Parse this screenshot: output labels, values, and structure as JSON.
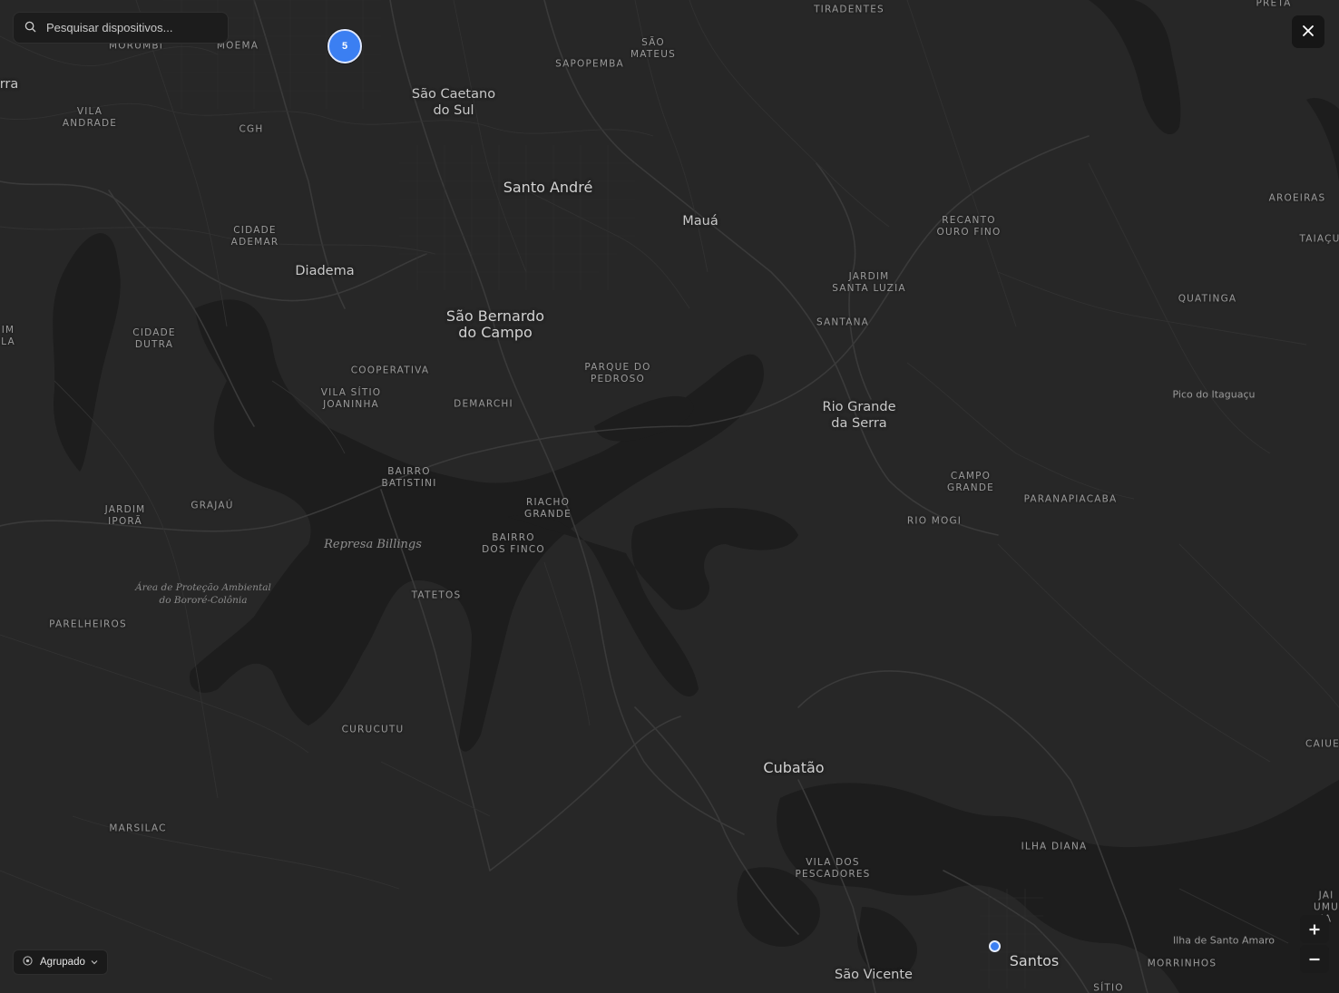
{
  "search": {
    "placeholder": "Pesquisar dispositivos..."
  },
  "cluster": {
    "count": "5"
  },
  "mode_selector": {
    "label": "Agrupado"
  },
  "zoom": {
    "in_label": "+",
    "out_label": "−"
  },
  "icons": {
    "search": "search-icon",
    "close": "close-icon",
    "mode": "target-icon",
    "chevron": "chevron-down-icon"
  },
  "colors": {
    "background": "#272727",
    "water": "#1d1d1d",
    "roads": "#3a3a3a",
    "marker": "#3b7ff2"
  },
  "map": {
    "cities": {
      "santo_andre": "Santo André",
      "sao_caetano": "São Caetano\ndo Sul",
      "maua": "Mauá",
      "diadema": "Diadema",
      "sao_bernardo": "São Bernardo\ndo Campo",
      "rio_grande_serra": "Rio Grande\nda Serra",
      "cubatao": "Cubatão",
      "santos": "Santos",
      "sao_vicente": "São Vicente",
      "edge_left": "rra"
    },
    "districts": {
      "tiradentes": "TIRADENTES",
      "preta": "PRETA",
      "morumbi": "MORUMBI",
      "moema": "MOEMA",
      "sao_mateus": "SÃO\nMATEUS",
      "sapopemba": "SAPOPEMBA",
      "vila_andrade": "VILA\nANDRADE",
      "cgh": "CGH",
      "aroeiras": "AROEIRAS",
      "recanto": "RECANTO\nOURO FINO",
      "taiacu": "TAIAÇU",
      "cidade_ademar": "CIDADE\nADEMAR",
      "jardim_santa_luzia": "JARDIM\nSANTA LUZIA",
      "quatinga": "QUATINGA",
      "im_la": "IM\nLA",
      "cidade_dutra": "CIDADE\nDUTRA",
      "santana": "SANTANA",
      "cooperativa": "COOPERATIVA",
      "parque_pedroso": "PARQUE DO\nPEDROSO",
      "vila_sitio": "VILA SÍTIO\nJOANINHA",
      "demarchi": "DEMARCHI",
      "bairro_batistini": "BAIRRO\nBATISTINI",
      "campo_grande": "CAMPO\nGRANDE",
      "paranapiacaba": "PARANAPIACABA",
      "jardim_ipora": "JARDIM\nIPORÃ",
      "grajau": "GRAJAÚ",
      "riacho_grande": "RIACHO\nGRANDE",
      "rio_mogi": "RIO MOGI",
      "bairro_finco": "BAIRRO\nDOS FINCO",
      "tatetos": "TATETOS",
      "parelheiros": "PARELHEIROS",
      "curucutu": "CURUCUTU",
      "caiue": "CAIUE",
      "marsilac": "MARSILAC",
      "ilha_diana": "ILHA DIANA",
      "vila_pescadores": "VILA DOS\nPESCADORES",
      "jar_umu": "JAI\nUMU\nJA",
      "morrinhos": "MORRINHOS",
      "sitio": "SÍTIO"
    },
    "natural": {
      "represa": "Represa Billings",
      "area_protecao": "Área de Proteção Ambiental\ndo Bororé-Colônia",
      "pico": "Pico do Itaguaçu",
      "ilha_santo_amaro": "Ilha de Santo Amaro"
    }
  }
}
